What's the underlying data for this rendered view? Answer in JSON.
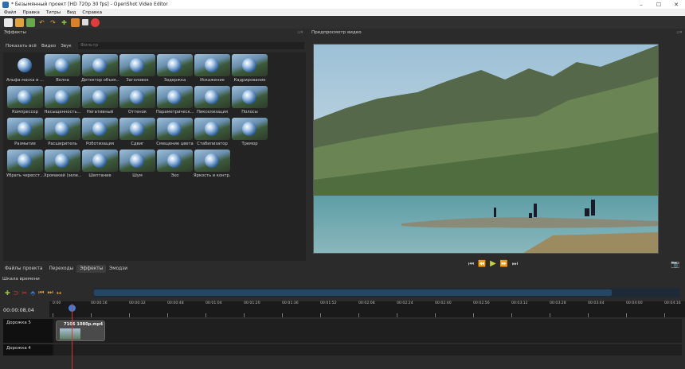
{
  "window": {
    "title": "* Безымянный проект [HD 720p 30 fps] - OpenShot Video Editor",
    "controls": [
      "–",
      "☐",
      "✕"
    ]
  },
  "menu": [
    "Файл",
    "Правка",
    "Титры",
    "Вид",
    "Справка"
  ],
  "effects_panel": {
    "title": "Эффекты",
    "tabs": [
      "Показать всё",
      "Видео",
      "Звук"
    ],
    "filter_placeholder": "Фильтр",
    "items": [
      "Альфа маска и ...",
      "Волна",
      "Детектор объек...",
      "Заголовок",
      "Задержка",
      "Искажение",
      "Кадрирование",
      "Компрессор",
      "Насыщенность...",
      "Негативный",
      "Оттенок",
      "Параметрическ...",
      "Пикселизация",
      "Полосы",
      "Размытие",
      "Расширитель",
      "Роботизация",
      "Сдвиг",
      "Смещение цвета",
      "Стабилизатор",
      "Тремор",
      "Убрать чересст...",
      "Хромакей (зеле...",
      "Шептание",
      "Шум",
      "Эхо",
      "Яркость и контр..."
    ]
  },
  "bottom_tabs": [
    "Файлы проекта",
    "Переходы",
    "Эффекты",
    "Эмодзи"
  ],
  "preview": {
    "title": "Предпросмотр видео",
    "controls": [
      "⏮",
      "⏪",
      "▶",
      "⏩",
      "⏭"
    ]
  },
  "timeline": {
    "title": "Шкала времени",
    "timecode": "00:00:08,04",
    "ruler": [
      "0:00",
      "00:00:16",
      "00:00:32",
      "00:00:48",
      "00:01:04",
      "00:01:20",
      "00:01:36",
      "00:01:52",
      "00:02:08",
      "00:02:24",
      "00:02:40",
      "00:02:56",
      "00:03:12",
      "00:03:28",
      "00:03:44",
      "00:04:00",
      "00:04:16"
    ],
    "tracks": [
      {
        "name": "Дорожка 5",
        "clip": "7106 1080p.mp4"
      },
      {
        "name": "Дорожка 4",
        "clip": ""
      }
    ]
  },
  "colors": {
    "background": "#2b2b2b",
    "accent_blue": "#3d7fd6",
    "record_red": "#e23b3b",
    "play_yellow": "#c7d13a"
  }
}
